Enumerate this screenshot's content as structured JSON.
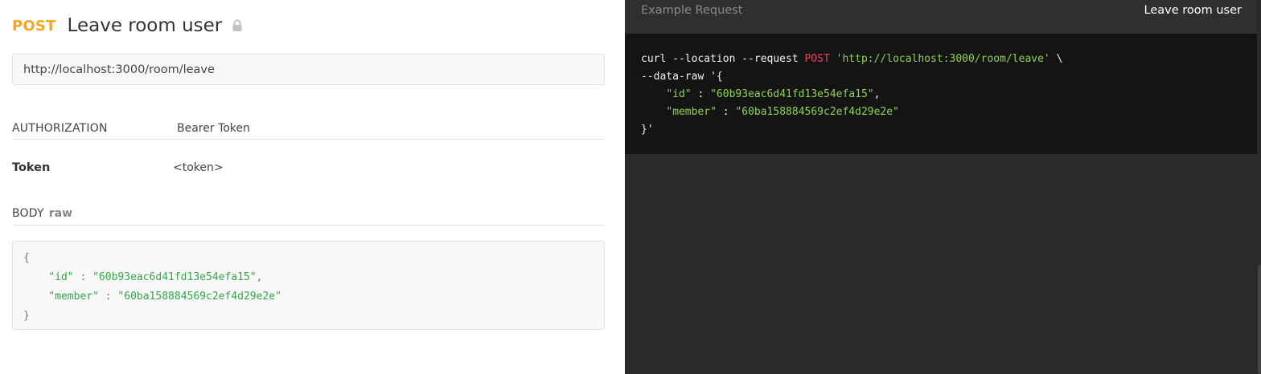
{
  "request": {
    "method": "POST",
    "name": "Leave room user",
    "url": "http://localhost:3000/room/leave"
  },
  "authorization": {
    "label": "AUTHORIZATION",
    "type": "Bearer Token",
    "token_key": "Token",
    "token_value": "<token>"
  },
  "body": {
    "label": "BODY",
    "mode": "raw",
    "lines": {
      "open": "{",
      "id_key": "\"id\"",
      "id_sep": " : ",
      "id_value": "\"60b93eac6d41fd13e54efa15\"",
      "id_comma": ",",
      "member_key": "\"member\"",
      "member_sep": " : ",
      "member_value": "\"60ba158884569c2ef4d29e2e\"",
      "close": "}"
    }
  },
  "example": {
    "label": "Example Request",
    "title": "Leave room user",
    "curl": {
      "prefix": "curl --location --request ",
      "method": "POST",
      "url": "'http://localhost:3000/room/leave'",
      "line1_suffix": " \\",
      "data_raw": "--data-raw '{",
      "id_key": "\"id\"",
      "id_sep": " : ",
      "id_value": "\"60b93eac6d41fd13e54efa15\"",
      "id_comma": ",",
      "member_key": "\"member\"",
      "member_sep": " : ",
      "member_value": "\"60ba158884569c2ef4d29e2e\"",
      "close": "}'"
    }
  },
  "colors": {
    "method": "#f4a623",
    "curl_method": "#e9435e",
    "curl_string": "#8ed15a",
    "body_string": "#34a64b",
    "dark_pane": "#2a2a2a",
    "code_bg": "#141414"
  },
  "icons": {
    "lock": "lock-icon"
  }
}
